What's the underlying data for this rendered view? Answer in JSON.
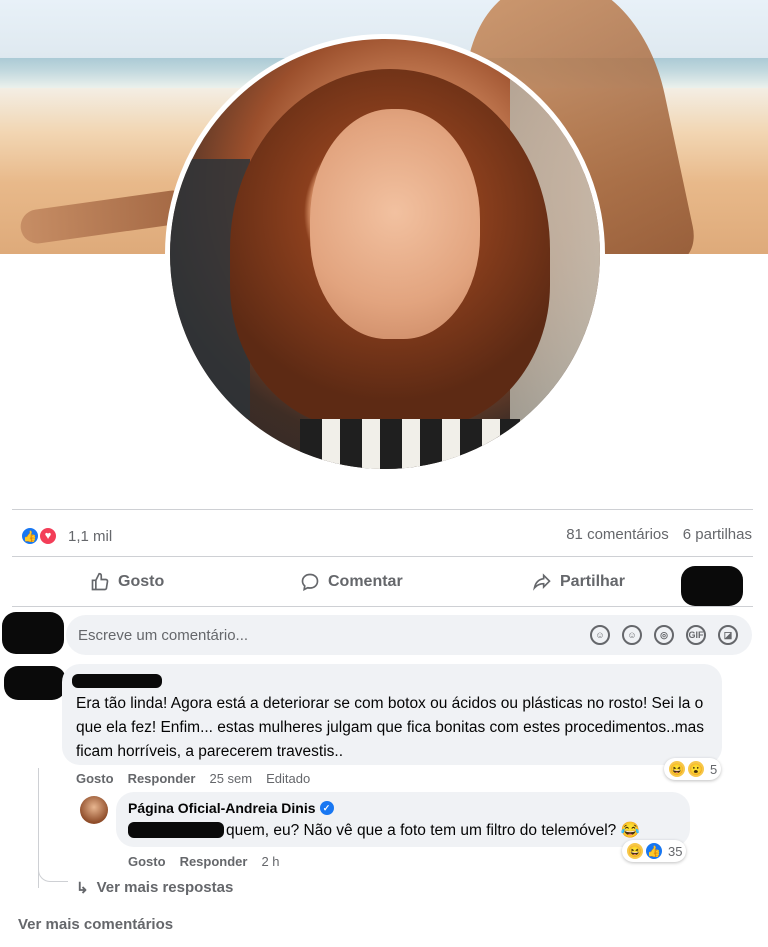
{
  "post": {
    "reactions_count": "1,1 mil",
    "comments_count": "81 comentários",
    "shares_count": "6 partilhas"
  },
  "actions": {
    "like": "Gosto",
    "comment": "Comentar",
    "share": "Partilhar"
  },
  "composer": {
    "placeholder": "Escreve um comentário..."
  },
  "comments": [
    {
      "text": "Era tão linda! Agora está a deteriorar se com botox ou ácidos ou plásticas no rosto! Sei la o que ela fez! Enfim... estas mulheres julgam que fica bonitas com estes procedimentos..mas ficam horríveis, a parecerem travestis..",
      "like_label": "Gosto",
      "reply_label": "Responder",
      "time": "25 sem",
      "edited": "Editado",
      "reaction_count": "5"
    }
  ],
  "reply": {
    "author": "Página Oficial-Andreia Dinis",
    "text": "quem, eu? Não vê que a foto tem um filtro do telemóvel? 😂",
    "like_label": "Gosto",
    "reply_label": "Responder",
    "time": "2 h",
    "reaction_count": "35"
  },
  "links": {
    "more_replies": "Ver mais respostas",
    "more_comments": "Ver mais comentários"
  }
}
